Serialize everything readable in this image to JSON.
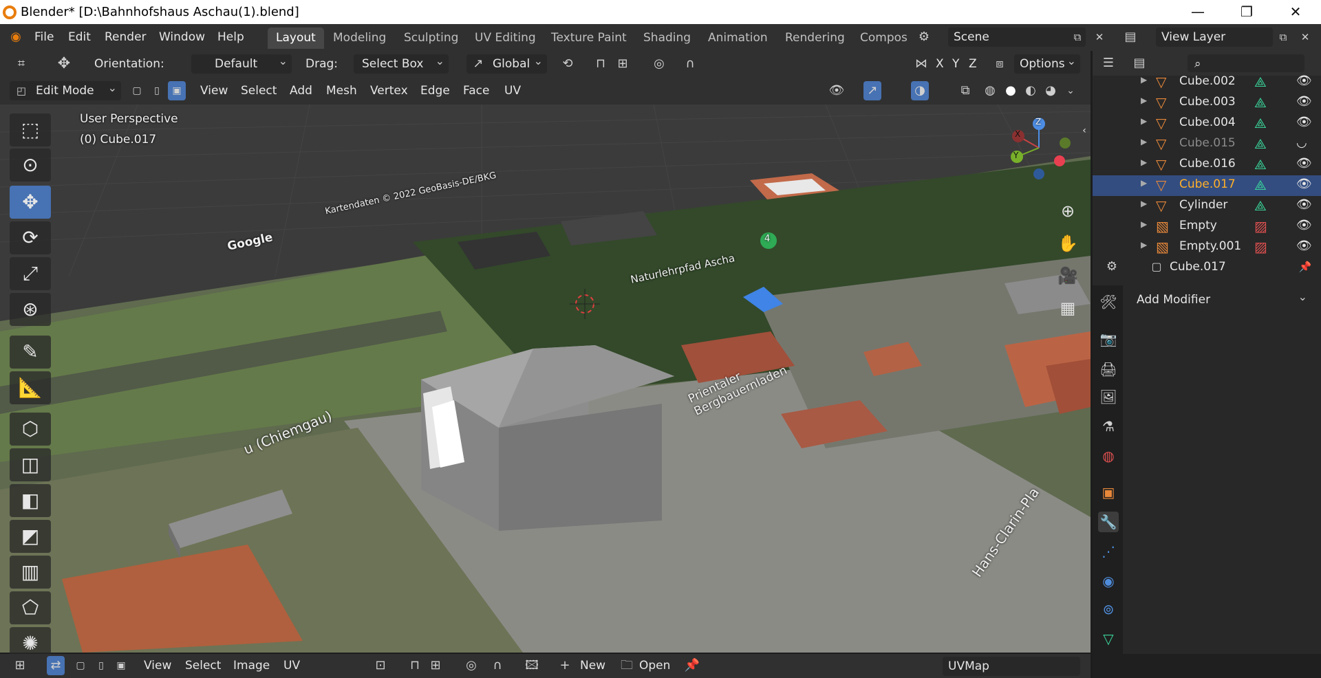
{
  "window": {
    "title": "Blender* [D:\\Bahnhofshaus Aschau(1).blend]",
    "minimize": "—",
    "maximize": "❐",
    "close": "✕"
  },
  "menu": [
    "File",
    "Edit",
    "Render",
    "Window",
    "Help"
  ],
  "workspaces": [
    "Layout",
    "Modeling",
    "Sculpting",
    "UV Editing",
    "Texture Paint",
    "Shading",
    "Animation",
    "Rendering",
    "Compos"
  ],
  "scene": {
    "name": "Scene",
    "view_layer": "View Layer"
  },
  "header1": {
    "orientation_label": "Orientation:",
    "orientation_value": "Default",
    "drag_label": "Drag:",
    "drag_value": "Select Box",
    "transform_value": "Global",
    "axes": [
      "X",
      "Y",
      "Z"
    ],
    "options_label": "Options"
  },
  "header2": {
    "mode": "Edit Mode",
    "menus": [
      "View",
      "Select",
      "Add",
      "Mesh",
      "Vertex",
      "Edge",
      "Face",
      "UV"
    ]
  },
  "viewport": {
    "perspective": "User Perspective",
    "object_info": "(0) Cube.017",
    "gizmo": {
      "x": "X",
      "y": "Y",
      "z": "Z"
    },
    "map_labels": {
      "google": "Google",
      "street1": "Naturlehrpfad Ascha",
      "shop": "Prientaler Bergbauernladen",
      "street2": "Hans-Clarin-Pla",
      "place": "u (Chiemgau)",
      "copyright": "Kartendaten © 2022 GeoBasis-DE/BKG",
      "marker": "4"
    }
  },
  "outliner": {
    "items": [
      {
        "name": "Cube.002",
        "state": "normal",
        "icon": "mesh-icon"
      },
      {
        "name": "Cube.003",
        "state": "normal",
        "icon": "mesh-icon"
      },
      {
        "name": "Cube.004",
        "state": "normal",
        "icon": "mesh-icon"
      },
      {
        "name": "Cube.015",
        "state": "hidden",
        "icon": "mesh-icon"
      },
      {
        "name": "Cube.016",
        "state": "normal",
        "icon": "mesh-icon"
      },
      {
        "name": "Cube.017",
        "state": "selected",
        "icon": "mesh-icon"
      },
      {
        "name": "Cylinder",
        "state": "normal",
        "icon": "mesh-icon"
      },
      {
        "name": "Empty",
        "state": "normal",
        "icon": "image-icon"
      },
      {
        "name": "Empty.001",
        "state": "normal",
        "icon": "image-icon"
      }
    ]
  },
  "properties": {
    "object_name": "Cube.017",
    "add_modifier": "Add Modifier"
  },
  "bottom": {
    "menus": [
      "View",
      "Select",
      "Image",
      "UV"
    ],
    "new_label": "New",
    "open_label": "Open",
    "uvmap": "UVMap"
  },
  "colors": {
    "accent": "#4772b3",
    "selected_text": "#ffaf29",
    "object_orange": "#e8883a",
    "mesh_green": "#3ad49a"
  }
}
